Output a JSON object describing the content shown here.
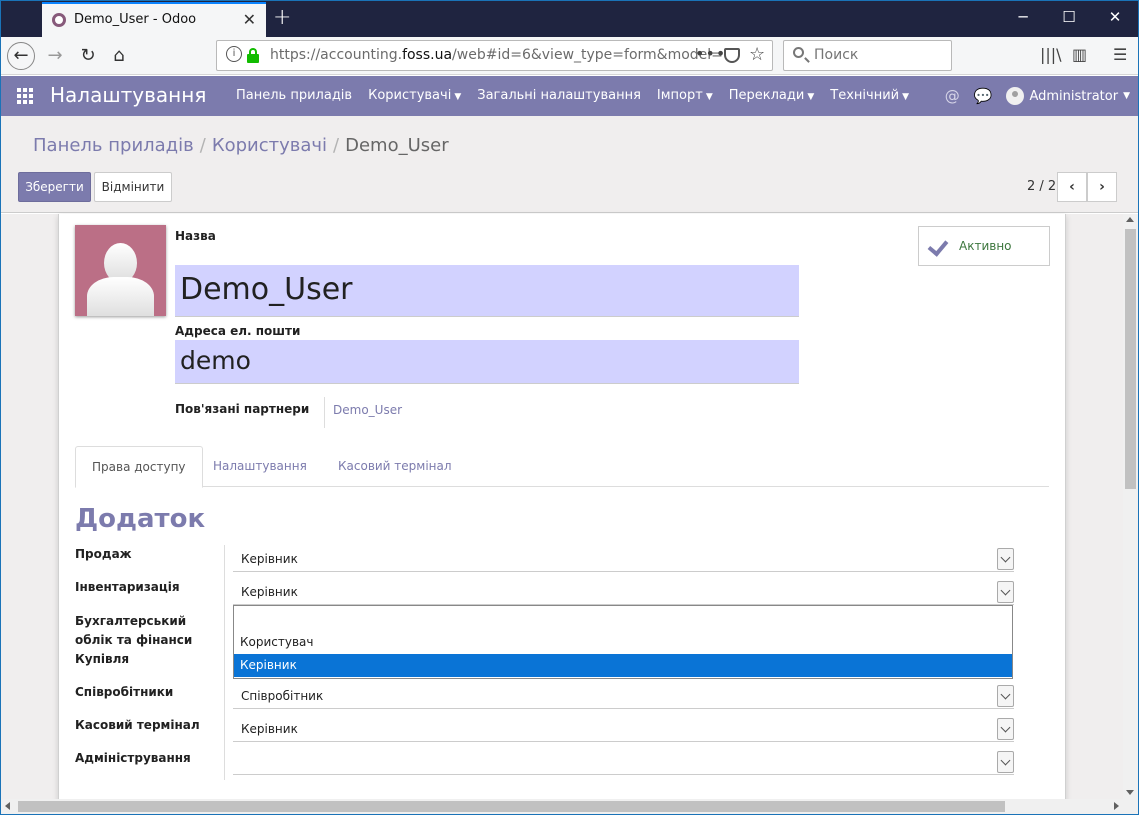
{
  "browser": {
    "tab_title": "Demo_User - Odoo",
    "new_tab": "+",
    "url_prefix": "https://accounting.",
    "url_domain": "foss.ua",
    "url_suffix": "/web#id=6&view_type=form&model=",
    "search_placeholder": "Поиск",
    "icons": [
      "back-icon",
      "forward-icon",
      "reload-icon",
      "home-icon",
      "info-icon",
      "lock-icon",
      "page-actions-icon",
      "pocket-icon",
      "bookmark-star-icon",
      "search-icon",
      "library-icon",
      "sidebar-icon",
      "hamburger-menu-icon"
    ]
  },
  "app": {
    "brand": "Налаштування",
    "menu": [
      {
        "label": "Панель приладів",
        "caret": false
      },
      {
        "label": "Користувачі",
        "caret": true
      },
      {
        "label": "Загальні налаштування",
        "caret": false
      },
      {
        "label": "Імпорт",
        "caret": true
      },
      {
        "label": "Переклади",
        "caret": true
      },
      {
        "label": "Технічний",
        "caret": true
      }
    ],
    "user": "Administrator",
    "accent_color": "#7c7bad"
  },
  "control_panel": {
    "breadcrumb": [
      "Панель приладів",
      "Користувачі",
      "Demo_User"
    ],
    "save_label": "Зберегти",
    "discard_label": "Відмінити",
    "pager": "2 / 2"
  },
  "form": {
    "name_label": "Назва",
    "name_value": "Demo_User",
    "email_label": "Адреса ел. пошти",
    "email_value": "demo",
    "active_label": "Активно",
    "partner_label": "Пов'язані партнери",
    "partner_value": "Demo_User",
    "tabs": [
      "Права доступу",
      "Налаштування",
      "Касовий термінал"
    ],
    "section_title": "Додаток",
    "rows": [
      {
        "label": "Продаж",
        "value": "Керівник"
      },
      {
        "label": "Інвентаризація",
        "value": "Керівник"
      },
      {
        "label": "Бухгалтерський облік та фінанси Купівля",
        "value": ""
      },
      {
        "label": "Співробітники",
        "value": "Співробітник"
      },
      {
        "label": "Касовий термінал",
        "value": "Керівник"
      },
      {
        "label": "Адміністрування",
        "value": ""
      }
    ],
    "dropdown_options": [
      "",
      "Користувач",
      "Керівник"
    ],
    "dropdown_selected": "Керівник"
  }
}
